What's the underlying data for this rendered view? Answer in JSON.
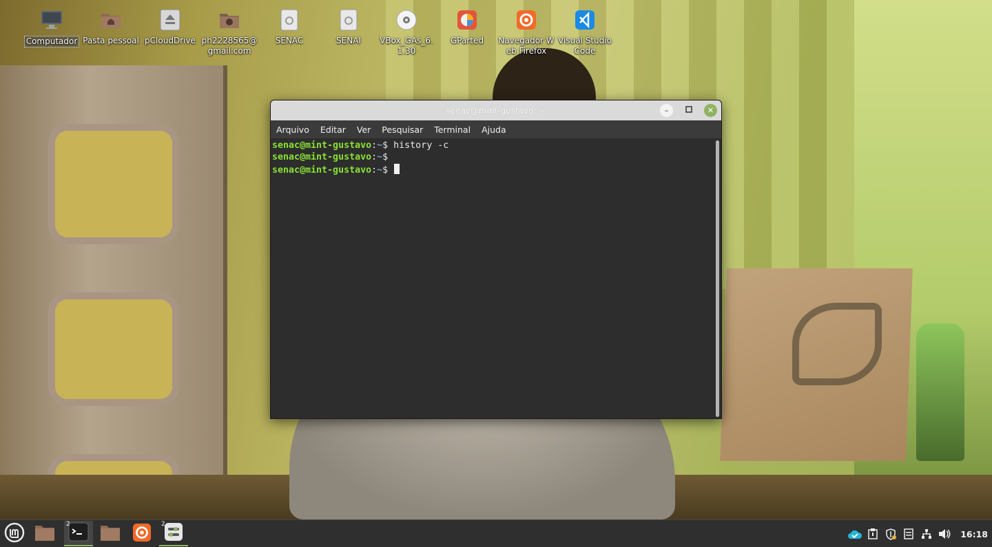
{
  "desktop": {
    "icons": [
      {
        "label": "Computador",
        "icon": "computer-icon",
        "selected": true
      },
      {
        "label": "Pasta pessoal",
        "icon": "home-folder-icon"
      },
      {
        "label": "pCloudDrive",
        "icon": "drive-eject-icon"
      },
      {
        "label": "ph2228565@gmail.com",
        "icon": "network-folder-icon"
      },
      {
        "label": "SENAC",
        "icon": "drive-icon"
      },
      {
        "label": "SENAI",
        "icon": "drive-icon"
      },
      {
        "label": "VBox_GAs_6.1.30",
        "icon": "optical-disc-icon"
      },
      {
        "label": "GParted",
        "icon": "gparted-icon"
      },
      {
        "label": "Navegador Web Firefox",
        "icon": "firefox-icon"
      },
      {
        "label": "Visual Studio Code",
        "icon": "vscode-icon"
      }
    ]
  },
  "terminal": {
    "title": "senac@mint-gustavo: ~",
    "menu": [
      "Arquivo",
      "Editar",
      "Ver",
      "Pesquisar",
      "Terminal",
      "Ajuda"
    ],
    "lines": [
      {
        "user": "senac@mint-gustavo",
        "sep": ":",
        "path": "~",
        "symbol": "$ ",
        "command": "history -c"
      },
      {
        "user": "senac@mint-gustavo",
        "sep": ":",
        "path": "~",
        "symbol": "$ ",
        "command": ""
      },
      {
        "user": "senac@mint-gustavo",
        "sep": ":",
        "path": "~",
        "symbol": "$ ",
        "command": ""
      }
    ]
  },
  "panel": {
    "apps": [
      {
        "name": "mint-menu-icon"
      },
      {
        "name": "files-icon"
      },
      {
        "name": "terminal-icon",
        "badge": "2"
      },
      {
        "name": "files-icon"
      },
      {
        "name": "firefox-icon"
      },
      {
        "name": "settings-icon",
        "badge": "2"
      }
    ],
    "tray": [
      "cloud-sync-icon",
      "clipboard-icon",
      "shield-icon",
      "notes-icon",
      "network-icon",
      "volume-icon"
    ],
    "clock": "16:18"
  },
  "colors": {
    "prompt_user": "#8ae234",
    "prompt_path": "#729fcf",
    "accent": "#8fb361"
  }
}
